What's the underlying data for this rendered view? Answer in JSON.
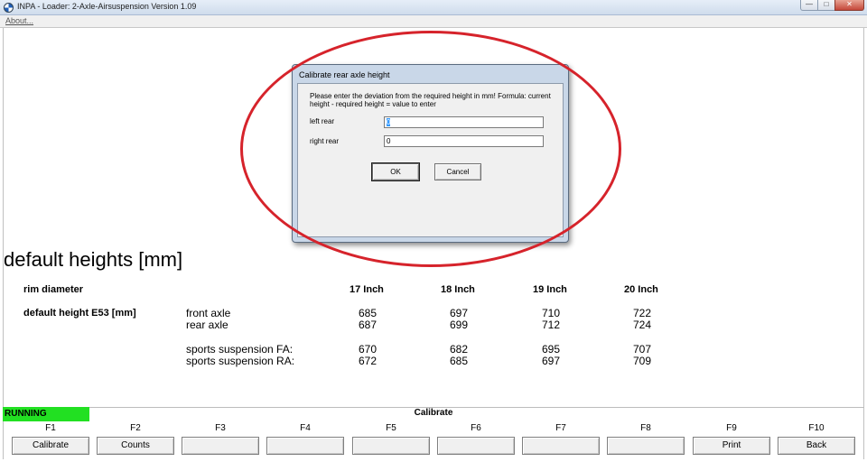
{
  "window": {
    "title": "INPA - Loader:  2-Axle-Airsuspension Version 1.09",
    "controls": {
      "minimize": "—",
      "maximize": "□",
      "close": "✕"
    }
  },
  "menu": {
    "about": "About..."
  },
  "content": {
    "heading": "default heights [mm]",
    "rim_label": "rim diameter",
    "default_label": "default height E53 [mm]",
    "columns": [
      "17 Inch",
      "18 Inch",
      "19 Inch",
      "20 Inch"
    ],
    "rows": [
      {
        "label": "front axle",
        "values": [
          "685",
          "697",
          "710",
          "722"
        ]
      },
      {
        "label": "rear axle",
        "values": [
          "687",
          "699",
          "712",
          "724"
        ]
      },
      {
        "label": "sports suspension FA:",
        "values": [
          "670",
          "682",
          "695",
          "707"
        ]
      },
      {
        "label": "sports suspension RA:",
        "values": [
          "672",
          "685",
          "697",
          "709"
        ]
      }
    ]
  },
  "status": {
    "state": "RUNNING",
    "state_color": "#22e022",
    "title": "Calibrate"
  },
  "function_keys": [
    {
      "key": "F1",
      "label": "Calibrate"
    },
    {
      "key": "F2",
      "label": "Counts"
    },
    {
      "key": "F3",
      "label": ""
    },
    {
      "key": "F4",
      "label": ""
    },
    {
      "key": "F5",
      "label": ""
    },
    {
      "key": "F6",
      "label": ""
    },
    {
      "key": "F7",
      "label": ""
    },
    {
      "key": "F8",
      "label": ""
    },
    {
      "key": "F9",
      "label": "Print"
    },
    {
      "key": "F10",
      "label": "Back"
    }
  ],
  "dialog": {
    "title": "Calibrate rear axle height",
    "instruction": "Please enter the deviation from the required height in mm! Formula: current height - required height = value to enter",
    "left_label": "left rear",
    "left_value": "0",
    "right_label": "right rear",
    "right_value": "0",
    "ok_label": "OK",
    "cancel_label": "Cancel"
  },
  "annotation_color": "#d6232b"
}
